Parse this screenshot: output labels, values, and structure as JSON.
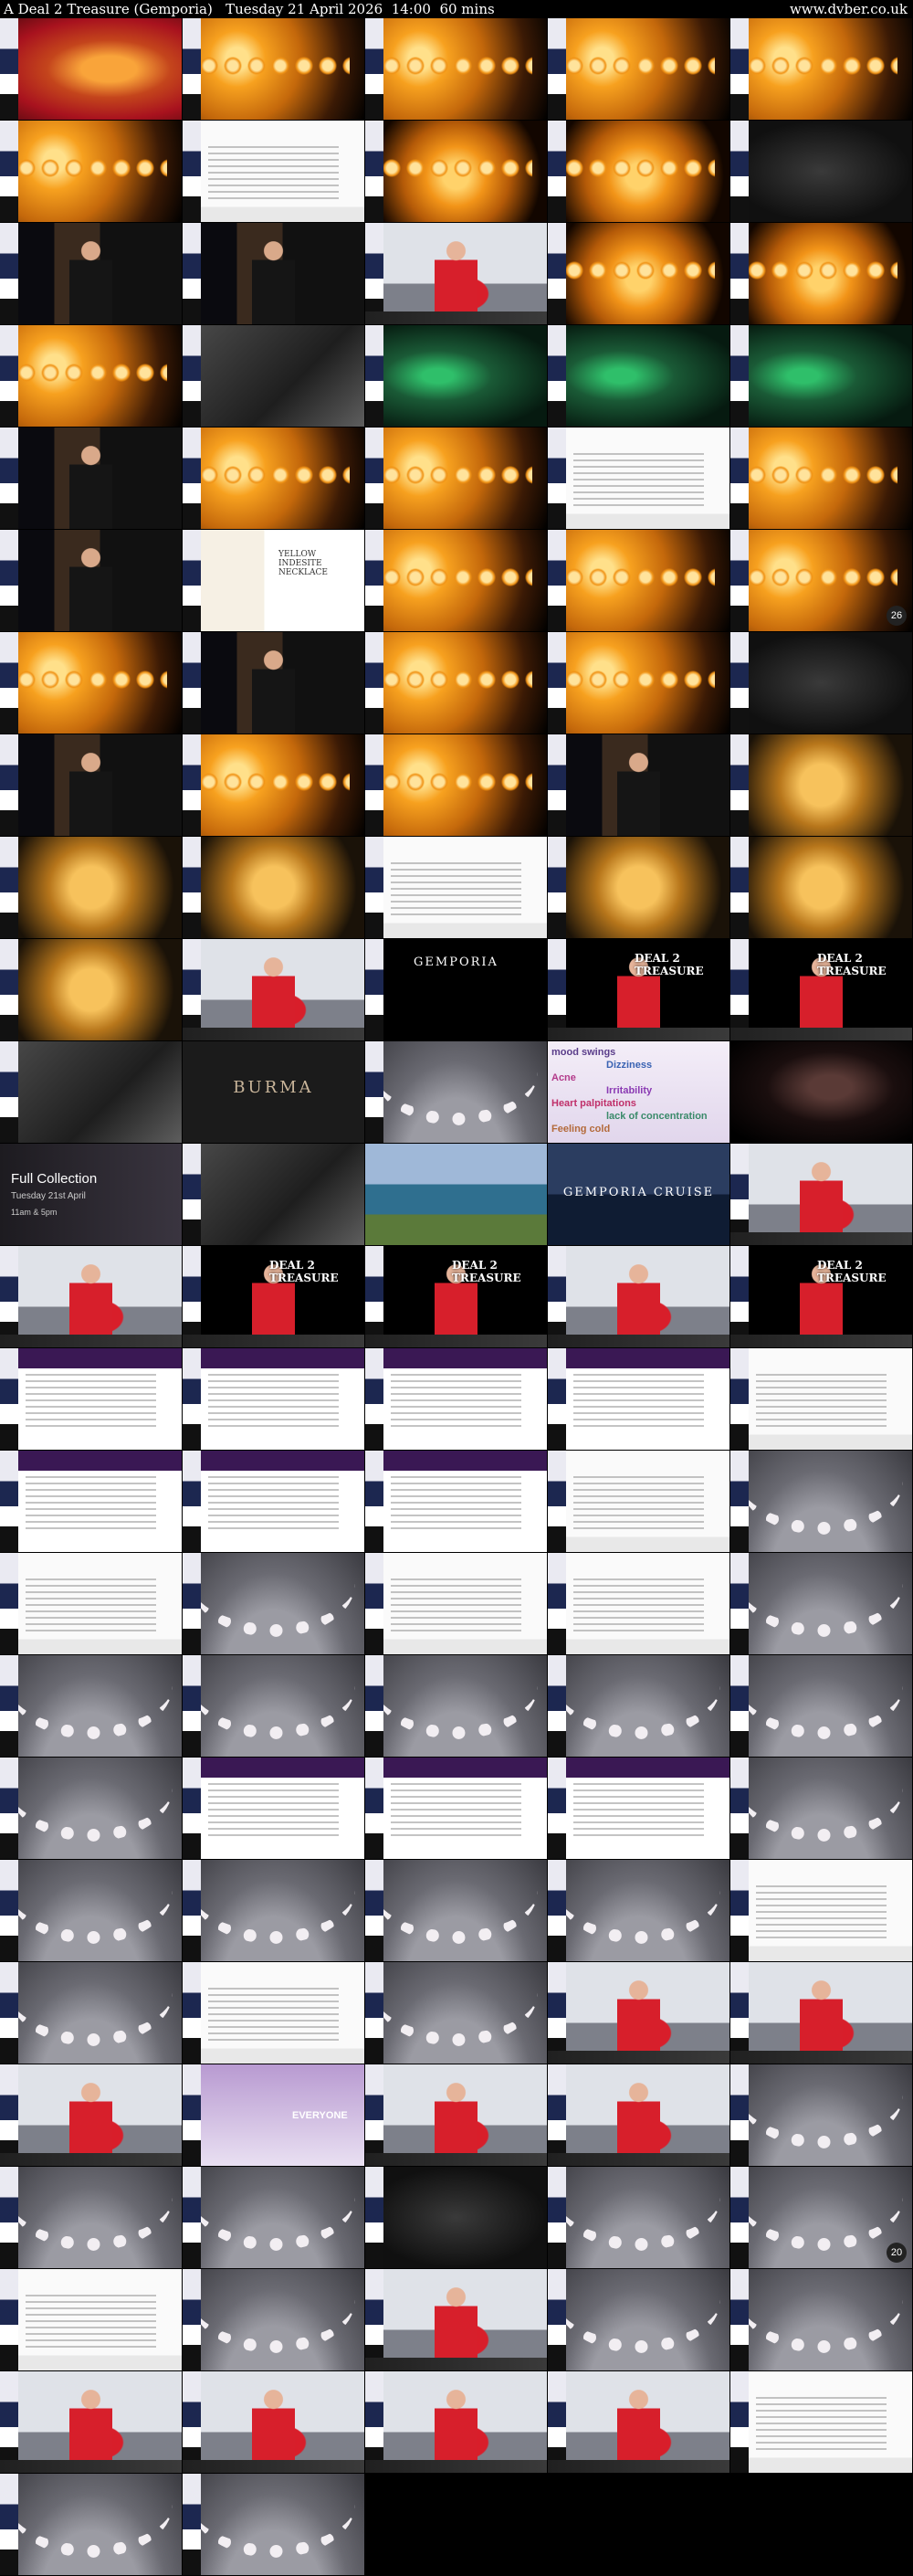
{
  "header": {
    "title": "A Deal 2 Treasure (Gemporia)   Tuesday 21 April 2026  14:00  60 mins",
    "site": "www.dvber.co.uk"
  },
  "overlays": {
    "burma": "BURMA",
    "yellow_necklace": "YELLOW INDESITE NECKLACE",
    "full_collection": "Full Collection",
    "full_collection_date": "Tuesday 21st April",
    "full_collection_time": "11am & 5pm",
    "gemporia": "GEMPORIA",
    "gemporia_cruise": "GEMPORIA CRUISE",
    "deal2": "DEAL 2 TREASURE",
    "everyone": "EVERYONE",
    "badge_26": "26",
    "badge_20": "20",
    "words": [
      "mood swings",
      "Dizziness",
      "Acne",
      "Irritability",
      "Heart palpitations",
      "lack of concentration",
      "Feeling cold"
    ]
  },
  "thumbs": [
    "jewel-red",
    "amber",
    "amber",
    "amber",
    "amber",
    "amber",
    "white-doc",
    "amber2",
    "amber2",
    "dark",
    "presenter",
    "presenter",
    "presenter-red",
    "amber2",
    "amber2",
    "amber",
    "rock",
    "green",
    "green",
    "green",
    "presenter",
    "amber",
    "amber",
    "white-doc",
    "amber",
    "presenter",
    "yellow",
    "amber",
    "amber",
    "amber",
    "amber",
    "presenter",
    "amber",
    "amber",
    "dark",
    "presenter",
    "amber",
    "amber",
    "presenter",
    "gold",
    "gold",
    "gold",
    "white-doc",
    "gold",
    "gold",
    "gold",
    "presenter-red",
    "gemporia",
    "deal2",
    "deal2",
    "rock",
    "burma",
    "pearl",
    "words",
    "woman",
    "collection",
    "rock",
    "lake",
    "cruise",
    "presenter-red",
    "presenter-red",
    "deal2",
    "deal2",
    "presenter-red",
    "deal2",
    "purple",
    "purple",
    "purple",
    "purple",
    "white-doc",
    "purple",
    "purple",
    "purple",
    "white-doc",
    "pearl",
    "white-doc",
    "pearl",
    "white-doc",
    "white-doc",
    "pearl",
    "pearl",
    "pearl",
    "pearl",
    "pearl",
    "pearl",
    "pearl",
    "purple",
    "purple",
    "purple",
    "pearl",
    "pearl",
    "pearl",
    "pearl",
    "pearl",
    "white-doc",
    "pearl",
    "white-doc",
    "pearl",
    "presenter-red",
    "presenter-red",
    "presenter-red",
    "pearls-purple",
    "presenter-red",
    "presenter-red",
    "pearl",
    "pearl",
    "pearl",
    "dark",
    "pearl",
    "pearl",
    "white-doc",
    "pearl",
    "presenter-red",
    "pearl",
    "pearl",
    "presenter-red",
    "presenter-red",
    "presenter-red",
    "presenter-red",
    "white-doc",
    "pearl",
    "pearl"
  ]
}
